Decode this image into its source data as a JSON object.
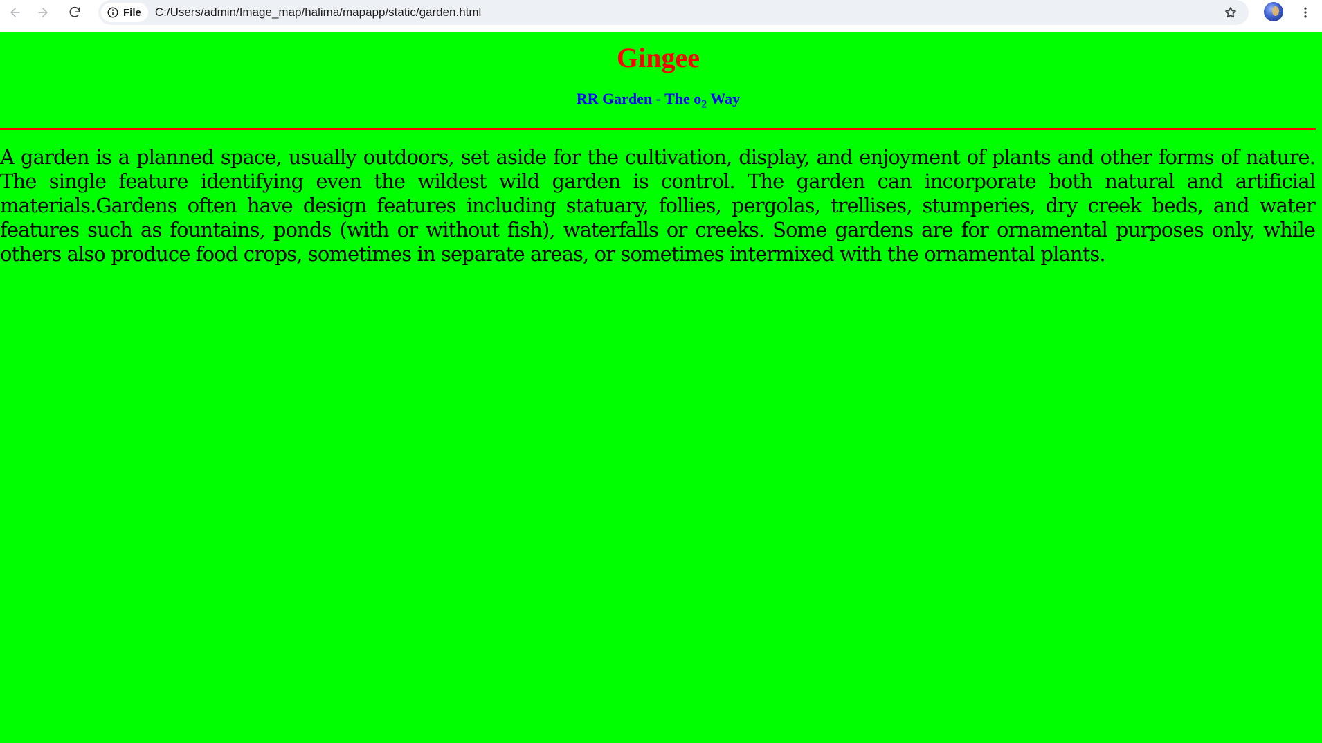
{
  "browser": {
    "site_chip_label": "File",
    "url": "C:/Users/admin/Image_map/halima/mapapp/static/garden.html",
    "icons": [
      "back-icon",
      "forward-icon",
      "reload-icon",
      "info-icon",
      "star-icon",
      "avatar",
      "kebab-menu-icon"
    ]
  },
  "page": {
    "title": "Gingee",
    "subtitle_pre": "RR Garden - The o",
    "subtitle_sub": "2",
    "subtitle_post": " Way",
    "body": "A garden is a planned space, usually outdoors, set aside for the cultivation, display, and enjoyment of plants and other forms of nature. The single feature identifying even the wildest wild garden is control. The garden can incorporate both natural and artificial materials.Gardens often have design features including statuary, follies, pergolas, trellises, stumperies, dry creek beds, and water features such as fountains, ponds (with or without fish), waterfalls or creeks. Some gardens are for ornamental purposes only, while others also produce food crops, sometimes in separate areas, or sometimes intermixed with the ornamental plants.",
    "colors": {
      "background": "#00ff00",
      "title": "#ff0000",
      "subtitle": "#0000ff",
      "divider": "#ff0000",
      "body_text": "#000000"
    }
  }
}
